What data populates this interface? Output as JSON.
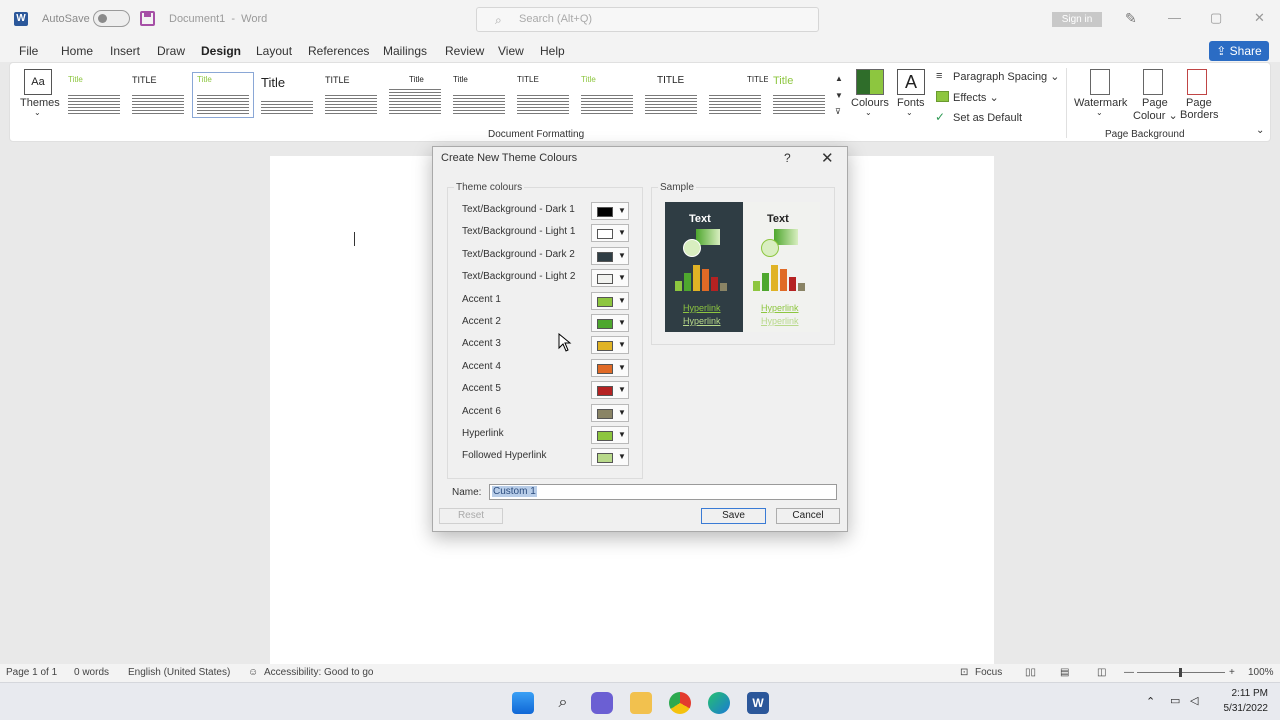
{
  "titlebar": {
    "autosave_label": "AutoSave",
    "document_name": "Document1",
    "app_name": "Word",
    "search_placeholder": "Search (Alt+Q)",
    "sign_in": "Sign in"
  },
  "menu": {
    "items": [
      "File",
      "Home",
      "Insert",
      "Draw",
      "Design",
      "Layout",
      "References",
      "Mailings",
      "Review",
      "View",
      "Help"
    ],
    "active": "Design",
    "share": "Share"
  },
  "ribbon": {
    "themes": "Themes",
    "style_titles": [
      "Title",
      "TITLE",
      "Title",
      "Title",
      "TITLE",
      "Title",
      "Title",
      "TITLE",
      "Title",
      "TITLE",
      "TITLE",
      "Title"
    ],
    "document_formatting": "Document Formatting",
    "colours": "Colours",
    "fonts": "Fonts",
    "paragraph_spacing": "Paragraph Spacing",
    "effects": "Effects",
    "set_as_default": "Set as Default",
    "watermark": "Watermark",
    "page_colour_1": "Page",
    "page_colour_2": "Colour",
    "page_borders_1": "Page",
    "page_borders_2": "Borders",
    "page_background": "Page Background"
  },
  "dialog": {
    "title": "Create New Theme Colours",
    "help": "?",
    "theme_colours_label": "Theme colours",
    "sample_label": "Sample",
    "rows": [
      {
        "label": "Text/Background - Dark 1",
        "color": "#000000"
      },
      {
        "label": "Text/Background - Light 1",
        "color": "#ffffff"
      },
      {
        "label": "Text/Background - Dark 2",
        "color": "#2f3d44"
      },
      {
        "label": "Text/Background - Light 2",
        "color": "#f1f2ef"
      },
      {
        "label": "Accent 1",
        "color": "#8dc63f"
      },
      {
        "label": "Accent 2",
        "color": "#4ea72e"
      },
      {
        "label": "Accent 3",
        "color": "#e0b325"
      },
      {
        "label": "Accent 4",
        "color": "#e06a26"
      },
      {
        "label": "Accent 5",
        "color": "#b52222"
      },
      {
        "label": "Accent 6",
        "color": "#8a8465"
      },
      {
        "label": "Hyperlink",
        "color": "#8dc63f"
      },
      {
        "label": "Followed Hyperlink",
        "color": "#b8d98a"
      }
    ],
    "sample_text": "Text",
    "sample_hyperlink": "Hyperlink",
    "sample_followed": "Hyperlink",
    "name_label": "Name:",
    "name_value": "Custom 1",
    "reset": "Reset",
    "save": "Save",
    "cancel": "Cancel"
  },
  "status": {
    "page": "Page 1 of 1",
    "words": "0 words",
    "language": "English (United States)",
    "accessibility": "Accessibility: Good to go",
    "focus": "Focus",
    "zoom": "100%"
  },
  "taskbar": {
    "time": "2:11 PM",
    "date": "5/31/2022"
  }
}
